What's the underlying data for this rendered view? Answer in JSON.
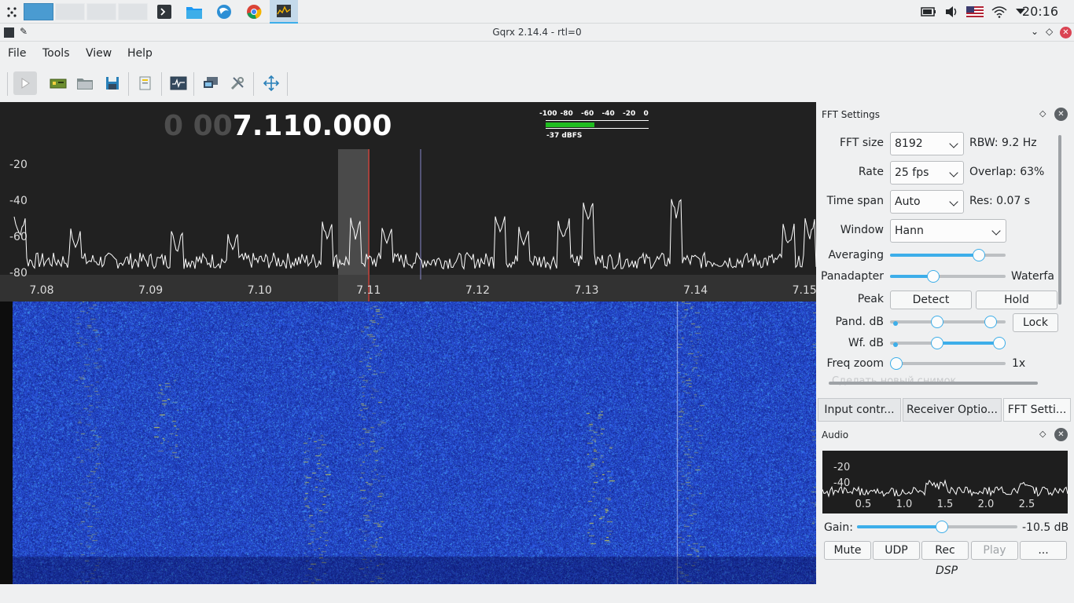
{
  "taskbar": {
    "time": "20:16",
    "app_icons": [
      "launcher-icon",
      "terminal-icon",
      "file-manager-icon",
      "browser-blue-icon",
      "chrome-icon",
      "gqrx-icon"
    ],
    "tray_icons": [
      "battery-icon",
      "volume-icon",
      "us-flag-icon",
      "wifi-icon",
      "tray-menu-icon"
    ]
  },
  "window": {
    "title": "Gqrx 2.14.4 - rtl=0"
  },
  "menu": {
    "file": "File",
    "tools": "Tools",
    "view": "View",
    "help": "Help"
  },
  "toolbar": {
    "icons": [
      "start-icon",
      "io-devices-icon",
      "open-icon",
      "save-icon",
      "remote-control-icon",
      "waterfall-icon",
      "network-icon",
      "settings-icon",
      "center-fft-icon"
    ]
  },
  "receiver": {
    "freq_dim": "0 00",
    "freq_main": "7.110.000"
  },
  "meter": {
    "scale": [
      "-100",
      "-80",
      "-60",
      "-40",
      "-20",
      "0"
    ],
    "reading": "-37 dBFS",
    "level_fraction": 0.58
  },
  "spectrum": {
    "y_ticks": [
      "-20",
      "-40",
      "-60",
      "-80"
    ],
    "x_ticks": [
      "7.08",
      "7.09",
      "7.10",
      "7.11",
      "7.12",
      "7.13",
      "7.14",
      "7.15"
    ],
    "filter_center": "7.11"
  },
  "fft": {
    "panel_title": "FFT Settings",
    "fft_size_label": "FFT size",
    "fft_size_value": "8192",
    "rbw": "RBW: 9.2 Hz",
    "rate_label": "Rate",
    "rate_value": "25 fps",
    "overlap": "Overlap: 63%",
    "time_span_label": "Time span",
    "time_span_value": "Auto",
    "res": "Res: 0.07 s",
    "window_label": "Window",
    "window_value": "Hann",
    "averaging_label": "Averaging",
    "averaging_level": 0.8,
    "panadapter_label": "Panadapter",
    "waterfall_label": "Waterfa",
    "pan_wf_level": 0.36,
    "peak_label": "Peak",
    "detect_label": "Detect",
    "hold_label": "Hold",
    "pand_db_label": "Pand. dB",
    "wf_db_label": "Wf. dB",
    "lock_label": "Lock",
    "freq_zoom_label": "Freq zoom",
    "freq_zoom_value": "1x",
    "ghost_text": "Сделать новый снимок"
  },
  "tabs": [
    "Input contr...",
    "Receiver Optio...",
    "FFT Setti..."
  ],
  "audio": {
    "panel_title": "Audio",
    "y_ticks": [
      "-20",
      "-40"
    ],
    "x_ticks": [
      "0.5",
      "1.0",
      "1.5",
      "2.0",
      "2.5"
    ],
    "gain_label": "Gain:",
    "gain_value": "-10.5 dB",
    "gain_level": 0.53,
    "buttons": [
      "Mute",
      "UDP",
      "Rec",
      "Play",
      "..."
    ],
    "dsp_label": "DSP"
  },
  "colors": {
    "accent": "#3daee9",
    "spectrum_bg": "#212121",
    "waterfall_bg": "#1a3ba8",
    "filter_line": "#ff3b30"
  }
}
